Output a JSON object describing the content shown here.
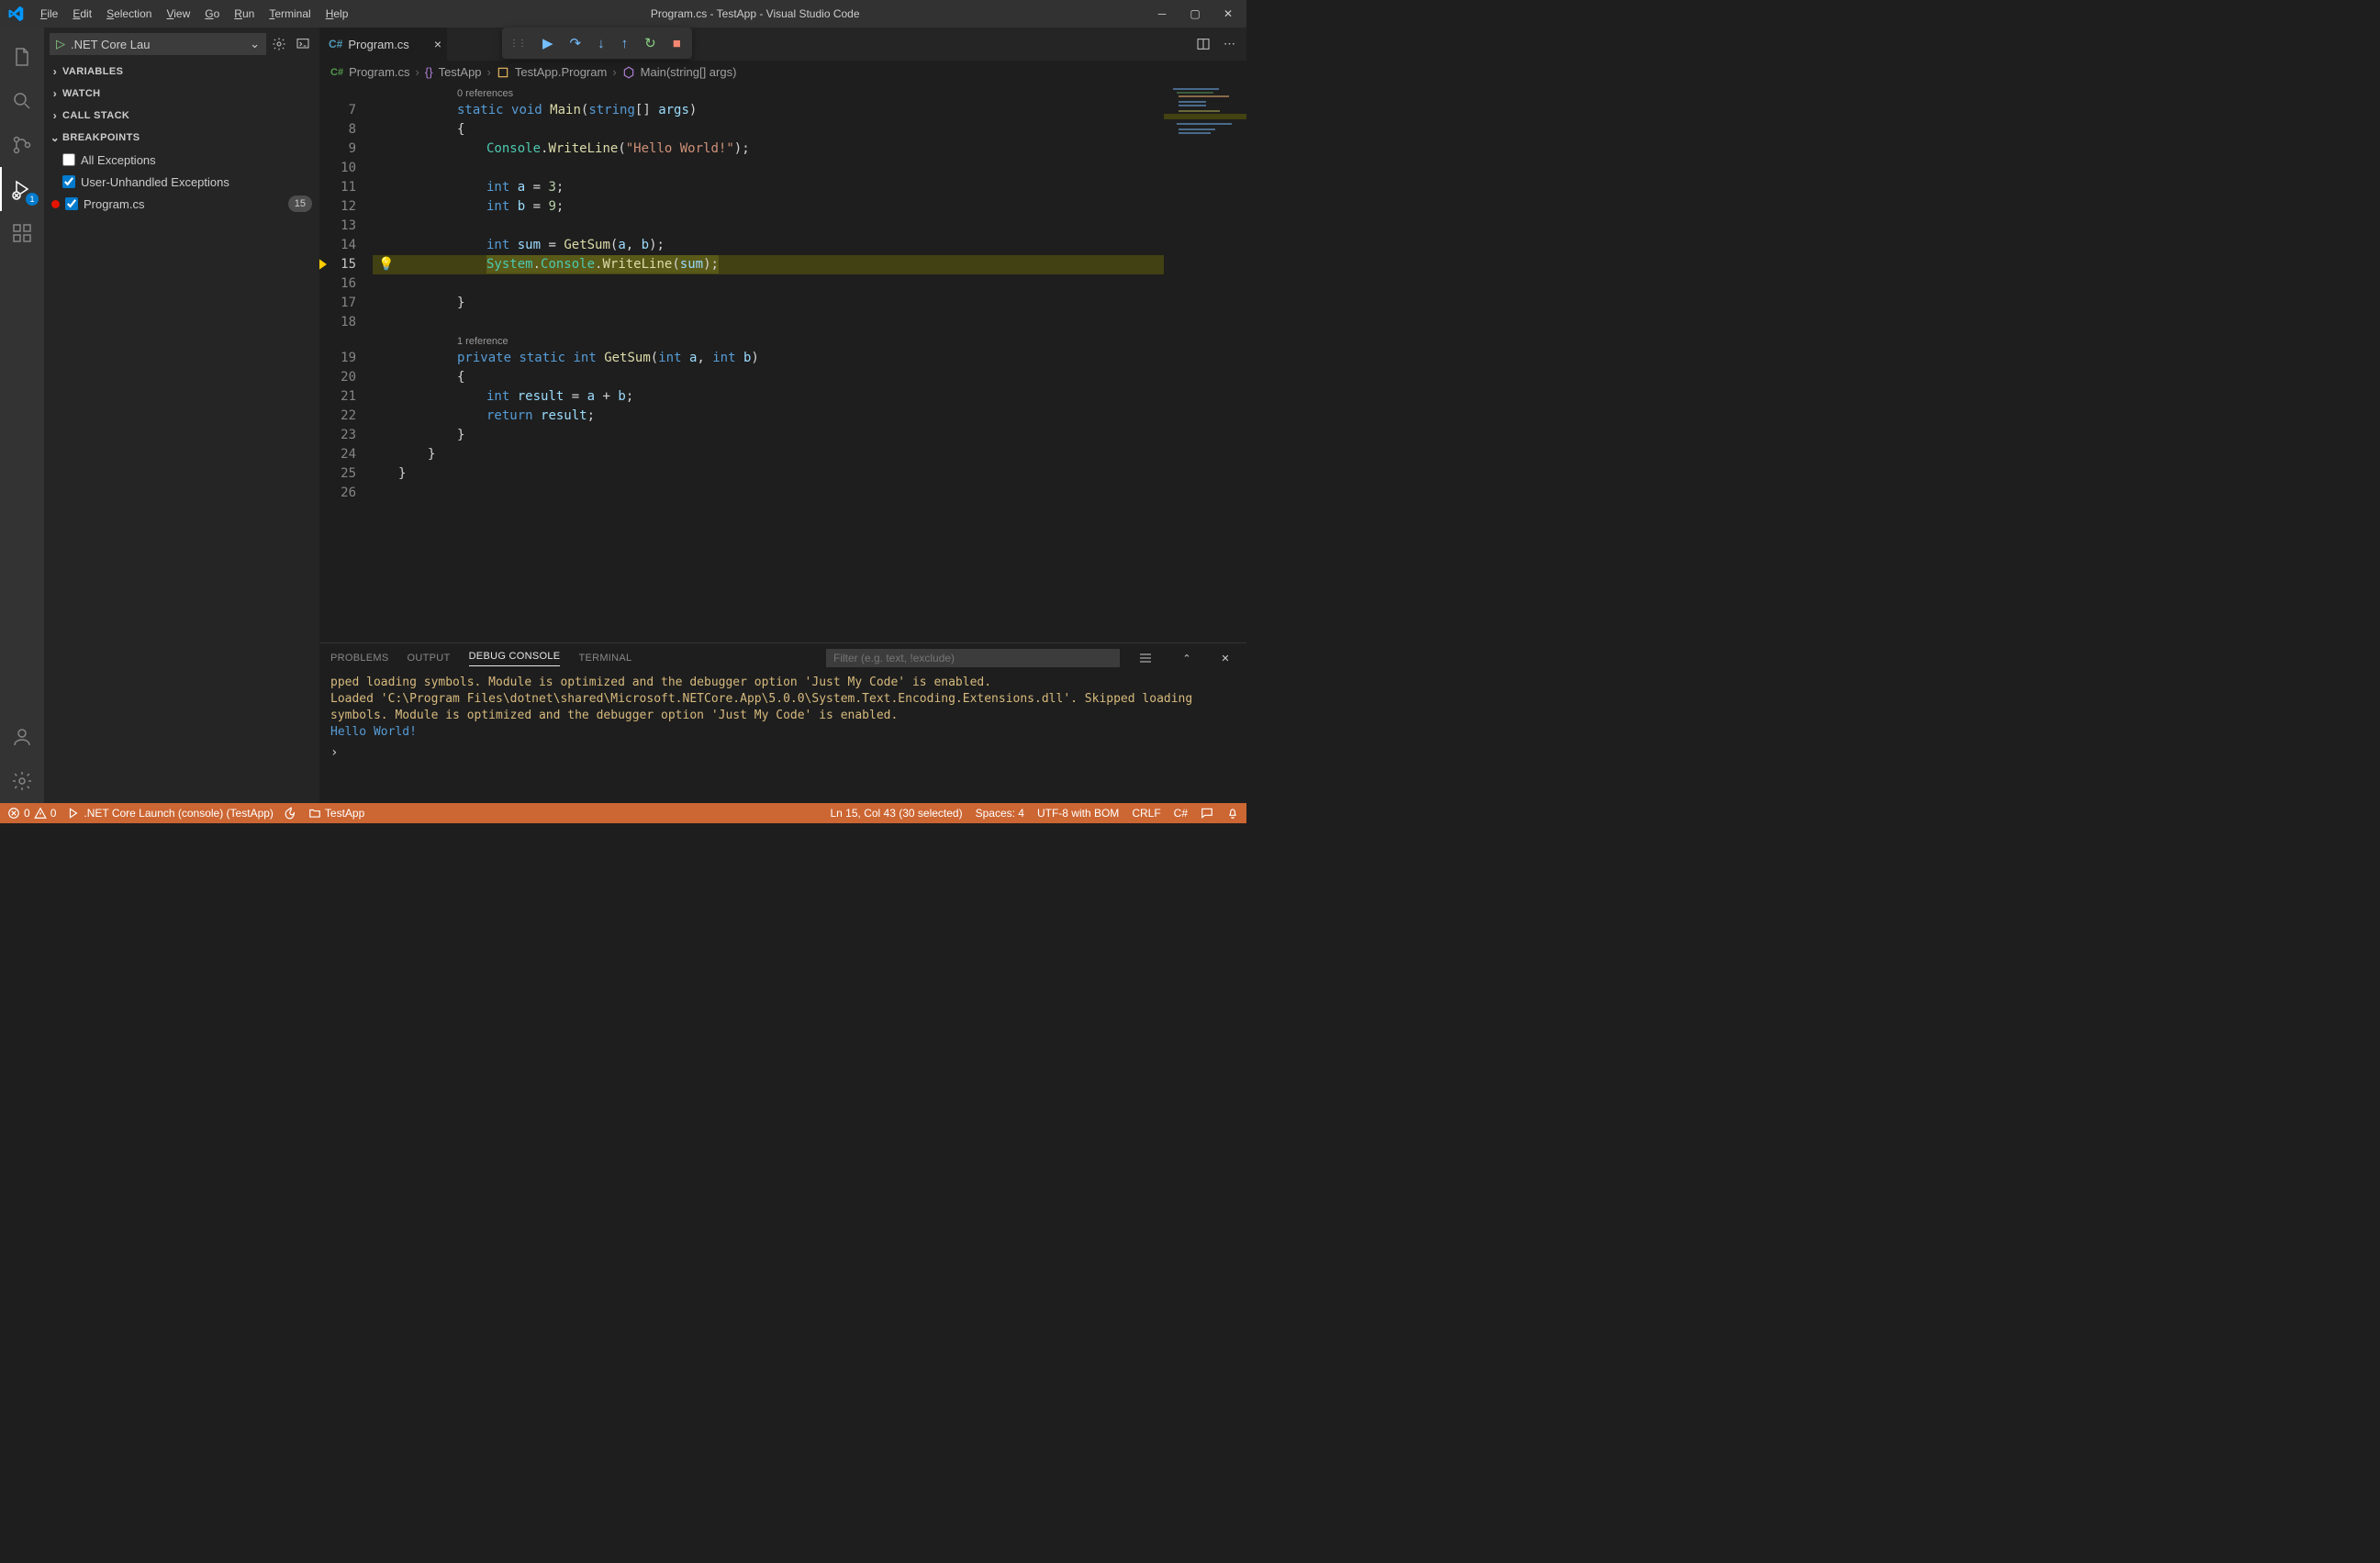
{
  "titlebar": {
    "menus": [
      "File",
      "Edit",
      "Selection",
      "View",
      "Go",
      "Run",
      "Terminal",
      "Help"
    ],
    "title": "Program.cs - TestApp - Visual Studio Code"
  },
  "activitybar": {
    "run_badge": "1"
  },
  "sidebar": {
    "launch_config": ".NET Core Lau",
    "sections": {
      "variables": "VARIABLES",
      "watch": "WATCH",
      "callstack": "CALL STACK",
      "breakpoints": "BREAKPOINTS"
    },
    "breakpoints": {
      "all_exceptions": {
        "label": "All Exceptions",
        "checked": false
      },
      "user_unhandled": {
        "label": "User-Unhandled Exceptions",
        "checked": true
      },
      "file": {
        "label": "Program.cs",
        "line": "15",
        "checked": true
      }
    }
  },
  "tab": {
    "name": "Program.cs"
  },
  "breadcrumbs": {
    "file": "Program.cs",
    "namespace": "TestApp",
    "class": "TestApp.Program",
    "method": "Main(string[] args)"
  },
  "code": {
    "codelens_top": "0 references",
    "codelens_mid": "1 reference",
    "lines": {
      "l7": {
        "n": "7",
        "html": "<span class='kw'>static</span> <span class='kw'>void</span> <span class='fn'>Main</span><span class='pln'>(</span><span class='kw'>string</span><span class='pln'>[] </span><span class='var'>args</span><span class='pln'>)</span>",
        "indent": 80
      },
      "l8": {
        "n": "8",
        "html": "<span class='pln'>{</span>",
        "indent": 80
      },
      "l9": {
        "n": "9",
        "html": "<span class='cls2'>Console</span><span class='pln'>.</span><span class='fn'>WriteLine</span><span class='pln'>(</span><span class='str'>\"Hello World!\"</span><span class='pln'>);</span>",
        "indent": 112
      },
      "l10": {
        "n": "10",
        "html": "",
        "indent": 112
      },
      "l11": {
        "n": "11",
        "html": "<span class='kw'>int</span> <span class='var'>a</span> <span class='pln'>=</span> <span class='num'>3</span><span class='pln'>;</span>",
        "indent": 112
      },
      "l12": {
        "n": "12",
        "html": "<span class='kw'>int</span> <span class='var'>b</span> <span class='pln'>=</span> <span class='num'>9</span><span class='pln'>;</span>",
        "indent": 112
      },
      "l13": {
        "n": "13",
        "html": "",
        "indent": 112
      },
      "l14": {
        "n": "14",
        "html": "<span class='kw'>int</span> <span class='var'>sum</span> <span class='pln'>=</span> <span class='fn'>GetSum</span><span class='pln'>(</span><span class='var'>a</span><span class='pln'>, </span><span class='var'>b</span><span class='pln'>);</span>",
        "indent": 112
      },
      "l15": {
        "n": "15",
        "html": "<span class='cls2'>System</span><span class='pln'>.</span><span class='cls2'>Console</span><span class='pln'>.</span><span class='fn'>WriteLine</span><span class='pln'>(</span><span class='var'>sum</span><span class='pln'>);</span>",
        "indent": 112
      },
      "l16": {
        "n": "16",
        "html": "",
        "indent": 112
      },
      "l17": {
        "n": "17",
        "html": "<span class='pln'>}</span>",
        "indent": 80
      },
      "l18": {
        "n": "18",
        "html": "",
        "indent": 80
      },
      "l19": {
        "n": "19",
        "html": "<span class='kw'>private</span> <span class='kw'>static</span> <span class='kw'>int</span> <span class='fn'>GetSum</span><span class='pln'>(</span><span class='kw'>int</span> <span class='var'>a</span><span class='pln'>, </span><span class='kw'>int</span> <span class='var'>b</span><span class='pln'>)</span>",
        "indent": 80
      },
      "l20": {
        "n": "20",
        "html": "<span class='pln'>{</span>",
        "indent": 80
      },
      "l21": {
        "n": "21",
        "html": "<span class='kw'>int</span> <span class='var'>result</span> <span class='pln'>=</span> <span class='var'>a</span> <span class='pln'>+</span> <span class='var'>b</span><span class='pln'>;</span>",
        "indent": 112
      },
      "l22": {
        "n": "22",
        "html": "<span class='kw'>return</span> <span class='var'>result</span><span class='pln'>;</span>",
        "indent": 112
      },
      "l23": {
        "n": "23",
        "html": "<span class='pln'>}</span>",
        "indent": 80
      },
      "l24": {
        "n": "24",
        "html": "<span class='pln'>}</span>",
        "indent": 48
      },
      "l25": {
        "n": "25",
        "html": "<span class='pln'>}</span>",
        "indent": 16
      },
      "l26": {
        "n": "26",
        "html": "",
        "indent": 0
      }
    },
    "current_line": "15"
  },
  "panel": {
    "tabs": {
      "problems": "PROBLEMS",
      "output": "OUTPUT",
      "debug": "DEBUG CONSOLE",
      "terminal": "TERMINAL"
    },
    "filter_placeholder": "Filter (e.g. text, !exclude)",
    "out1": "pped loading symbols. Module is optimized and the debugger option 'Just My Code' is enabled.",
    "out2": "Loaded 'C:\\Program Files\\dotnet\\shared\\Microsoft.NETCore.App\\5.0.0\\System.Text.Encoding.Extensions.dll'. Skipped loading symbols. Module is optimized and the debugger option 'Just My Code' is enabled.",
    "out3": "Hello World!"
  },
  "statusbar": {
    "errors": "0",
    "warnings": "0",
    "launch": ".NET Core Launch (console) (TestApp)",
    "folder": "TestApp",
    "position": "Ln 15, Col 43 (30 selected)",
    "spaces": "Spaces: 4",
    "encoding": "UTF-8 with BOM",
    "eol": "CRLF",
    "lang": "C#"
  }
}
